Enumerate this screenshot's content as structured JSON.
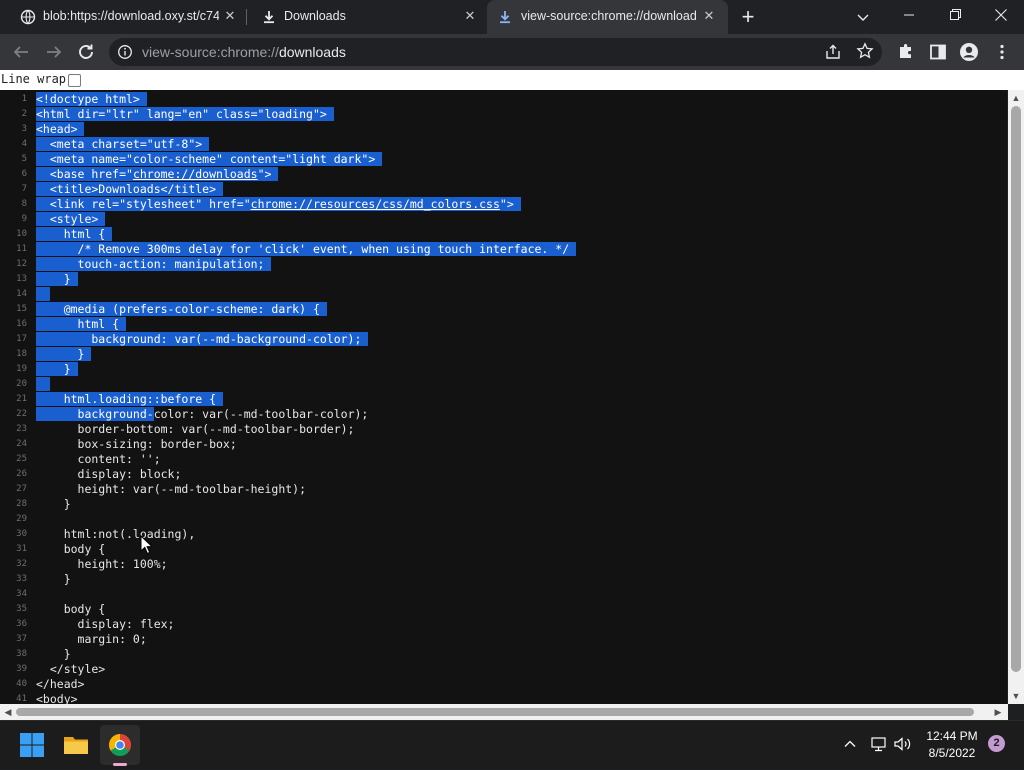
{
  "browser": {
    "tabs": [
      {
        "title": "blob:https://download.oxy.st/c74",
        "icon": "globe-icon",
        "close": "✕"
      },
      {
        "title": "Downloads",
        "icon": "download-icon",
        "close": "✕"
      },
      {
        "title": "view-source:chrome://downloads",
        "icon": "download-icon",
        "close": "✕",
        "active": true
      }
    ],
    "new_tab": "+",
    "address": {
      "prefix": "view-source:chrome://",
      "host": "downloads"
    }
  },
  "page": {
    "line_wrap_label": "Line wrap",
    "line_wrap_checked": false,
    "source_lines": [
      {
        "n": 1,
        "text": "<!doctype html>"
      },
      {
        "n": 2,
        "text": "<html dir=\"ltr\" lang=\"en\" class=\"loading\">"
      },
      {
        "n": 3,
        "text": "<head>"
      },
      {
        "n": 4,
        "text": "  <meta charset=\"utf-8\">"
      },
      {
        "n": 5,
        "text": "  <meta name=\"color-scheme\" content=\"light dark\">"
      },
      {
        "n": 6,
        "text": "  <base href=\"chrome://downloads\">",
        "link": "chrome://downloads"
      },
      {
        "n": 7,
        "text": "  <title>Downloads</title>"
      },
      {
        "n": 8,
        "text": "  <link rel=\"stylesheet\" href=\"chrome://resources/css/md_colors.css\">",
        "link": "chrome://resources/css/md_colors.css"
      },
      {
        "n": 9,
        "text": "  <style>"
      },
      {
        "n": 10,
        "text": "    html {"
      },
      {
        "n": 11,
        "text": "      /* Remove 300ms delay for 'click' event, when using touch interface. */"
      },
      {
        "n": 12,
        "text": "      touch-action: manipulation;"
      },
      {
        "n": 13,
        "text": "    }"
      },
      {
        "n": 14,
        "text": ""
      },
      {
        "n": 15,
        "text": "    @media (prefers-color-scheme: dark) {"
      },
      {
        "n": 16,
        "text": "      html {"
      },
      {
        "n": 17,
        "text": "        background: var(--md-background-color);"
      },
      {
        "n": 18,
        "text": "      }"
      },
      {
        "n": 19,
        "text": "    }"
      },
      {
        "n": 20,
        "text": ""
      },
      {
        "n": 21,
        "text": "    html.loading::before {"
      },
      {
        "n": 22,
        "text": "      background-color: var(--md-toolbar-color);"
      },
      {
        "n": 23,
        "text": "      border-bottom: var(--md-toolbar-border);"
      },
      {
        "n": 24,
        "text": "      box-sizing: border-box;"
      },
      {
        "n": 25,
        "text": "      content: '';"
      },
      {
        "n": 26,
        "text": "      display: block;"
      },
      {
        "n": 27,
        "text": "      height: var(--md-toolbar-height);"
      },
      {
        "n": 28,
        "text": "    }"
      },
      {
        "n": 29,
        "text": ""
      },
      {
        "n": 30,
        "text": "    html:not(.loading),"
      },
      {
        "n": 31,
        "text": "    body {"
      },
      {
        "n": 32,
        "text": "      height: 100%;"
      },
      {
        "n": 33,
        "text": "    }"
      },
      {
        "n": 34,
        "text": ""
      },
      {
        "n": 35,
        "text": "    body {"
      },
      {
        "n": 36,
        "text": "      display: flex;"
      },
      {
        "n": 37,
        "text": "      margin: 0;"
      },
      {
        "n": 38,
        "text": "    }"
      },
      {
        "n": 39,
        "text": "  </style>"
      },
      {
        "n": 40,
        "text": "</head>"
      },
      {
        "n": 41,
        "text": "<body>"
      }
    ]
  },
  "taskbar": {
    "apps": [
      "start-icon",
      "file-explorer-icon",
      "chrome-icon"
    ],
    "time": "12:44 PM",
    "date": "8/5/2022",
    "notification_count": "2"
  },
  "colors": {
    "selection": "#1a5fd0",
    "tag_color": "#6b9bd6",
    "taskbar_bg": "#1c1c1c"
  }
}
